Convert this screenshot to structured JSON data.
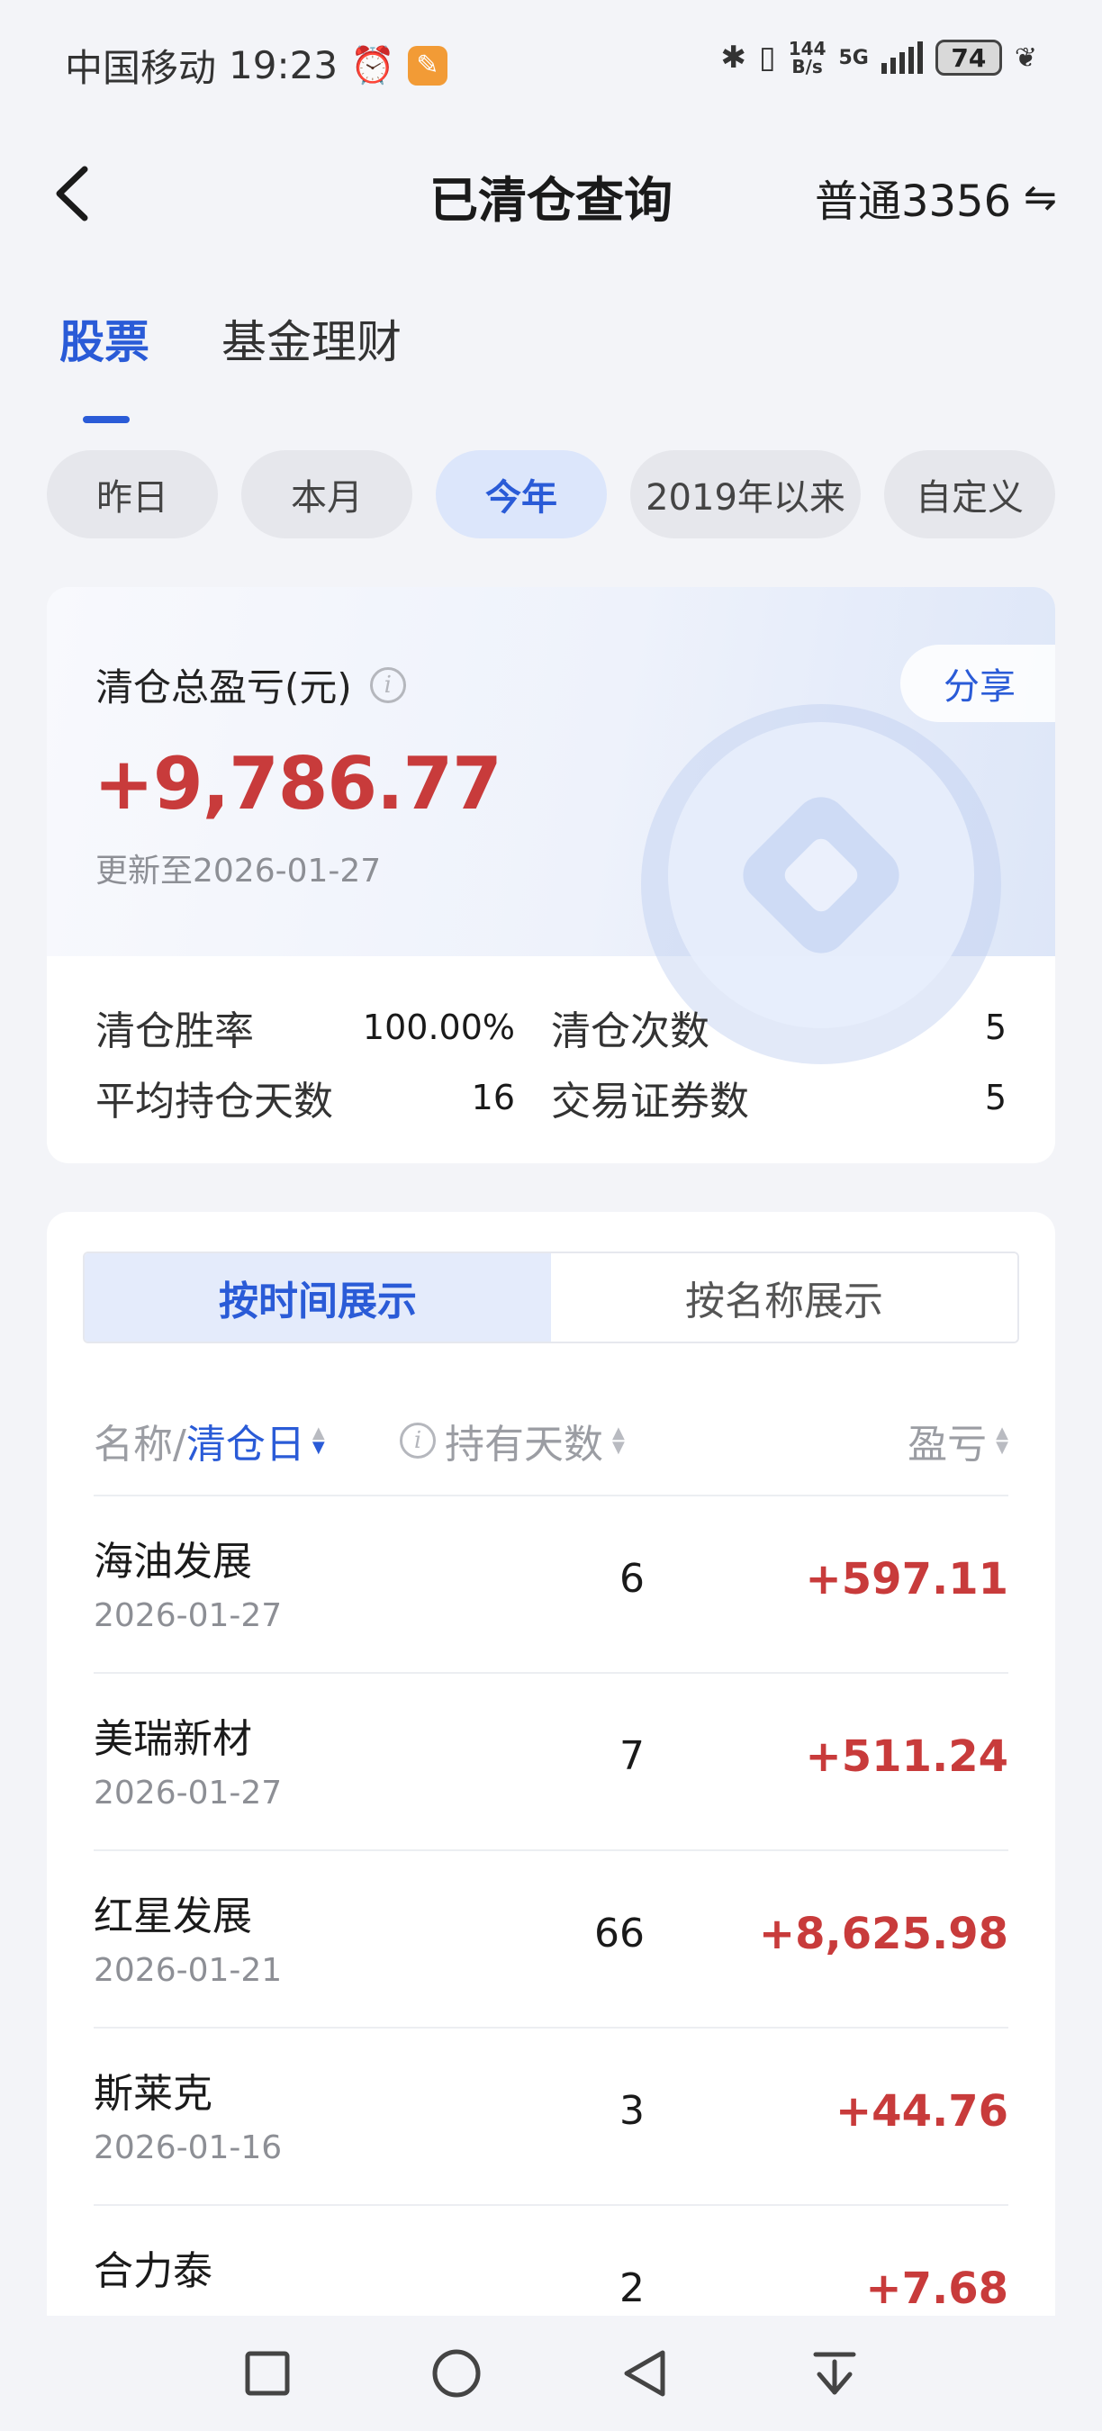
{
  "status_bar": {
    "carrier": "中国移动",
    "time": "19:23",
    "net_speed_value": "144",
    "net_speed_unit": "B/s",
    "network": "5G",
    "battery": "74"
  },
  "header": {
    "title": "已清仓查询",
    "account": "普通3356",
    "swap_symbol": "⇋"
  },
  "main_tabs": [
    {
      "label": "股票",
      "active": true
    },
    {
      "label": "基金理财",
      "active": false
    }
  ],
  "periods": [
    {
      "label": "昨日",
      "active": false
    },
    {
      "label": "本月",
      "active": false
    },
    {
      "label": "今年",
      "active": true
    },
    {
      "label": "2019年以来",
      "active": false
    },
    {
      "label": "自定义",
      "active": false
    }
  ],
  "summary": {
    "label": "清仓总盈亏(元)",
    "info_glyph": "i",
    "share": "分享",
    "total": "+9,786.77",
    "updated": "更新至2026-01-27",
    "stats": {
      "win_rate_label": "清仓胜率",
      "win_rate": "100.00%",
      "clear_count_label": "清仓次数",
      "clear_count": "5",
      "avg_days_label": "平均持仓天数",
      "avg_days": "16",
      "securities_label": "交易证券数",
      "securities": "5"
    }
  },
  "view_toggle": {
    "by_time": "按时间展示",
    "by_name": "按名称展示"
  },
  "table": {
    "col_name": "名称/",
    "col_sort_field": "清仓日",
    "col_days": "持有天数",
    "col_pnl": "盈亏",
    "rows": [
      {
        "name": "海油发展",
        "date": "2026-01-27",
        "days": "6",
        "pnl": "+597.11"
      },
      {
        "name": "美瑞新材",
        "date": "2026-01-27",
        "days": "7",
        "pnl": "+511.24"
      },
      {
        "name": "红星发展",
        "date": "2026-01-21",
        "days": "66",
        "pnl": "+8,625.98"
      },
      {
        "name": "斯莱克",
        "date": "2026-01-16",
        "days": "3",
        "pnl": "+44.76"
      },
      {
        "name": "合力泰",
        "date": "",
        "days": "2",
        "pnl": "+7.68"
      }
    ]
  },
  "colors": {
    "accent": "#2a5bd7",
    "profit": "#c83b3b",
    "background": "#f3f4f8"
  }
}
